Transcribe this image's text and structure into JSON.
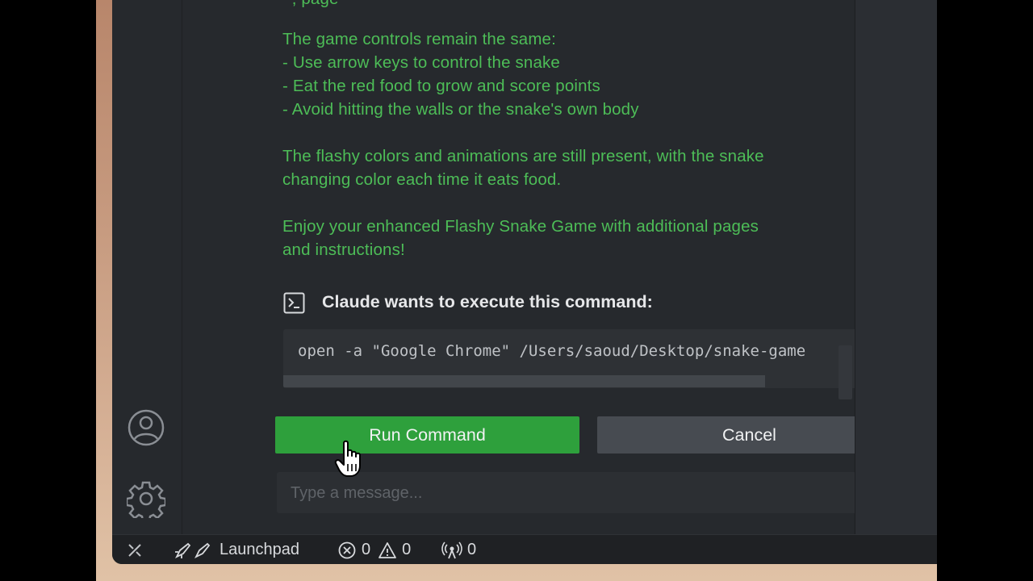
{
  "conversation": {
    "partial_line": "  , page",
    "controls_heading": "The game controls remain the same:",
    "controls": [
      "- Use arrow keys to control the snake",
      "- Eat the red food to grow and score points",
      "- Avoid hitting the walls or the snake's own body"
    ],
    "colors_line_1": "The flashy colors and animations are still present, with the snake",
    "colors_line_2": "changing color each time it eats food.",
    "enjoy_line_1": "Enjoy your enhanced Flashy Snake Game with additional pages",
    "enjoy_line_2": "and instructions!"
  },
  "command_request": {
    "title": "Claude wants to execute this command:",
    "command": "open -a \"Google Chrome\" /Users/saoud/Desktop/snake-game"
  },
  "buttons": {
    "run": "Run Command",
    "cancel": "Cancel"
  },
  "input": {
    "placeholder": "Type a message..."
  },
  "statusbar": {
    "launchpad": "Launchpad",
    "errors": "0",
    "warnings": "0",
    "ports": "0"
  },
  "icons": {
    "account": "account-icon",
    "settings": "gear-icon",
    "remote": "remote-icon",
    "send": "send-icon",
    "terminal": "terminal-icon"
  },
  "colors": {
    "accent_text": "#4dbd57",
    "run_button": "#2ea03c",
    "cancel_button": "#474b51",
    "panel_bg": "#26292d"
  }
}
